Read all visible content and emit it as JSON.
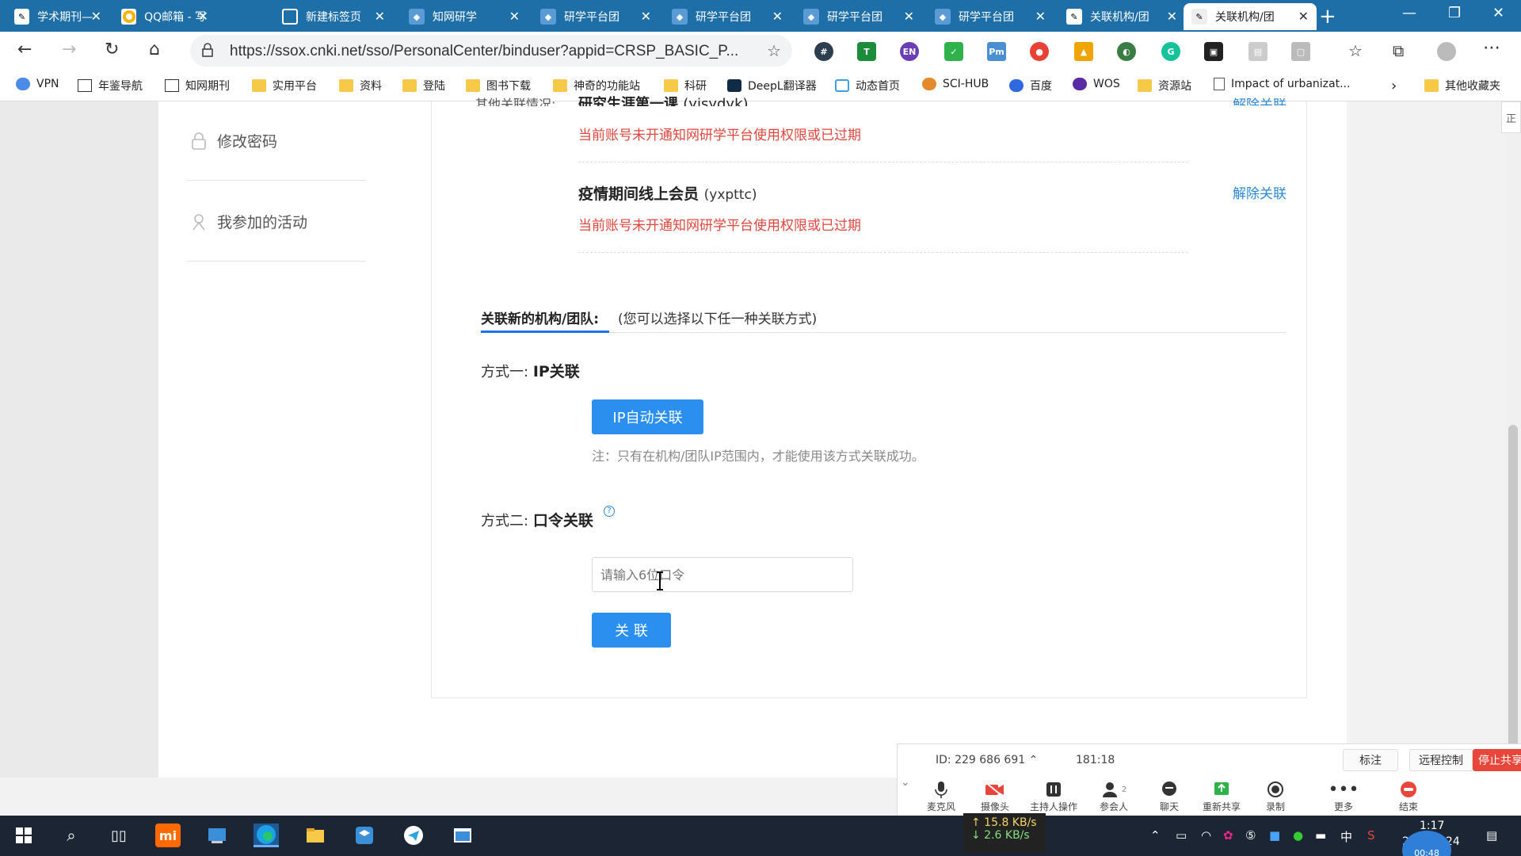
{
  "browser": {
    "tabs": [
      {
        "title": "学术期刊—",
        "favicon": "cnki-icon",
        "color": "#ffffff"
      },
      {
        "title": "QQ邮箱 - 写",
        "favicon": "qqmail-icon",
        "color": "#ffffff"
      },
      {
        "title": "新建标签页",
        "favicon": "newtab-icon",
        "color": "#ffffff"
      },
      {
        "title": "知网研学",
        "favicon": "yanxue-icon",
        "color": "#ffffff"
      },
      {
        "title": "研学平台团",
        "favicon": "yanxue-icon",
        "color": "#ffffff"
      },
      {
        "title": "研学平台团",
        "favicon": "yanxue-icon",
        "color": "#ffffff"
      },
      {
        "title": "研学平台团",
        "favicon": "yanxue-icon",
        "color": "#ffffff"
      },
      {
        "title": "研学平台团",
        "favicon": "yanxue-icon",
        "color": "#ffffff"
      },
      {
        "title": "关联机构/团",
        "favicon": "cnki-icon",
        "color": "#ffffff"
      },
      {
        "title": "关联机构/团",
        "favicon": "cnki-icon",
        "color": "#222222",
        "active": true
      }
    ],
    "url": "https://ssox.cnki.net/sso/PersonalCenter/binduser?appid=CRSP_BASIC_P...",
    "bookmarks": [
      {
        "label": "VPN",
        "icon": "vpn-icon"
      },
      {
        "label": "年鉴导航",
        "icon": "cnki-icon"
      },
      {
        "label": "知网期刊",
        "icon": "cnki-icon"
      },
      {
        "label": "实用平台",
        "icon": "folder-icon"
      },
      {
        "label": "资料",
        "icon": "folder-icon"
      },
      {
        "label": "登陆",
        "icon": "folder-icon"
      },
      {
        "label": "图书下载",
        "icon": "folder-icon"
      },
      {
        "label": "神奇的功能站",
        "icon": "folder-icon"
      },
      {
        "label": "科研",
        "icon": "folder-icon"
      },
      {
        "label": "DeepL翻译器",
        "icon": "deepl-icon"
      },
      {
        "label": "动态首页",
        "icon": "bilibili-icon"
      },
      {
        "label": "SCI-HUB",
        "icon": "scihub-icon"
      },
      {
        "label": "百度",
        "icon": "baidu-icon"
      },
      {
        "label": "WOS",
        "icon": "wos-icon"
      },
      {
        "label": "资源站",
        "icon": "folder-icon"
      },
      {
        "label": "Impact of urbanizat...",
        "icon": "doc-icon"
      }
    ],
    "other_bookmarks": "其他收藏夹"
  },
  "sidebar": {
    "items": [
      {
        "label": "修改密码",
        "icon": "lock-icon"
      },
      {
        "label": "我参加的活动",
        "icon": "activity-icon"
      }
    ]
  },
  "content": {
    "partial_top_left": "其他关联情况:",
    "partial_top_org": "研究生涯第一课",
    "partial_top_code": "(yjsydyk)",
    "partial_top_unlink": "解除关联",
    "warning_1": "当前账号未开通知网研学平台使用权限或已过期",
    "org_2_name": "疫情期间线上会员",
    "org_2_code": "(yxpttc)",
    "org_2_unlink": "解除关联",
    "warning_2": "当前账号未开通知网研学平台使用权限或已过期",
    "new_title": "关联新的机构/团队:",
    "new_tip": "(您可以选择以下任一种关联方式)",
    "method1_prefix": "方式一:",
    "method1_name": "IP关联",
    "ip_button": "IP自动关联",
    "ip_note": "注：只有在机构/团队IP范围内，才能使用该方式关联成功。",
    "method2_prefix": "方式二:",
    "method2_name": "口令关联",
    "method2_help": "?",
    "pwd_placeholder": "请输入6位口令",
    "pwd_value": "",
    "link_button": "关 联"
  },
  "meeting": {
    "id_text": "ID: 229 686 691",
    "elapsed": "181:18",
    "annotate": "标注",
    "remote": "远程控制",
    "stop_share": "停止共享",
    "controls": [
      {
        "label": "麦克风",
        "icon": "mic-icon"
      },
      {
        "label": "摄像头",
        "icon": "camera-off-icon"
      },
      {
        "label": "主持人操作",
        "icon": "host-icon"
      },
      {
        "label": "参会人",
        "icon": "participants-icon",
        "badge": "2"
      },
      {
        "label": "聊天",
        "icon": "chat-icon"
      },
      {
        "label": "重新共享",
        "icon": "share-icon"
      },
      {
        "label": "录制",
        "icon": "record-icon"
      },
      {
        "label": "更多",
        "icon": "more-icon"
      },
      {
        "label": "结束",
        "icon": "end-icon"
      }
    ]
  },
  "network": {
    "up": "↑ 15.8 KB/s",
    "down": "↓ 2.6 KB/s"
  },
  "taskbar": {
    "time": "1:17",
    "date": "2",
    "date_tail": "24",
    "bubble": "00:48",
    "ime": "中",
    "sidebar_tab": "正"
  },
  "colors": {
    "accent": "#2b8fef",
    "warning": "#e0463c",
    "link": "#2b88d8",
    "tabbar": "#1e6fa8"
  }
}
